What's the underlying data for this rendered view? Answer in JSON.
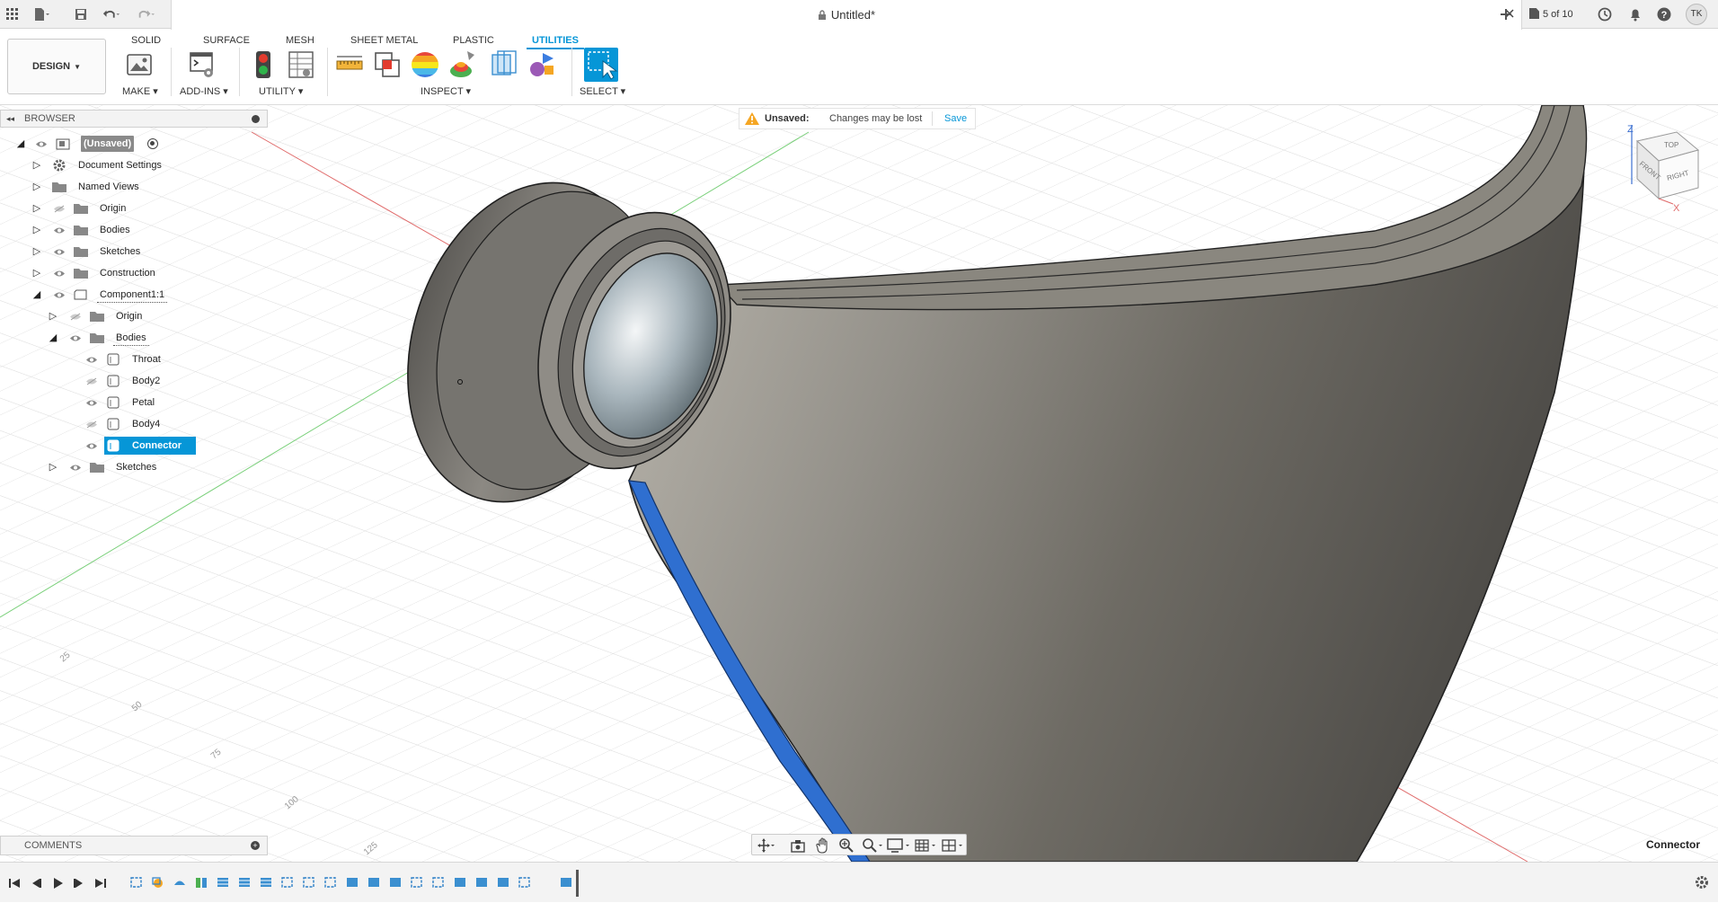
{
  "titlebar": {
    "doc_title": "Untitled*",
    "version_label": "5 of 10",
    "user_initials": "TK"
  },
  "ribbon": {
    "workspace": "DESIGN",
    "tabs": [
      "SOLID",
      "SURFACE",
      "MESH",
      "SHEET METAL",
      "PLASTIC",
      "UTILITIES"
    ],
    "active_tab": "UTILITIES",
    "groups": [
      "MAKE",
      "ADD-INS",
      "UTILITY",
      "INSPECT",
      "SELECT"
    ]
  },
  "browser": {
    "title": "BROWSER",
    "root": "(Unsaved)",
    "items": [
      "Document Settings",
      "Named Views",
      "Origin",
      "Bodies",
      "Sketches",
      "Construction",
      "Component1:1",
      "Origin",
      "Bodies",
      "Throat",
      "Body2",
      "Petal",
      "Body4",
      "Connector",
      "Sketches"
    ]
  },
  "unsaved_bar": {
    "label": "Unsaved:",
    "message": "Changes may be lost",
    "save": "Save"
  },
  "viewcube": {
    "top": "TOP",
    "front": "FRONT",
    "right": "RIGHT",
    "axis_z": "Z",
    "axis_x": "X"
  },
  "grid_labels": [
    "25",
    "50",
    "75",
    "100",
    "125"
  ],
  "comments": {
    "title": "COMMENTS"
  },
  "selection_label": "Connector",
  "colors": {
    "accent": "#0696d7",
    "selected_body": "#2f6fd0",
    "body_grey": "#7d7a72"
  }
}
